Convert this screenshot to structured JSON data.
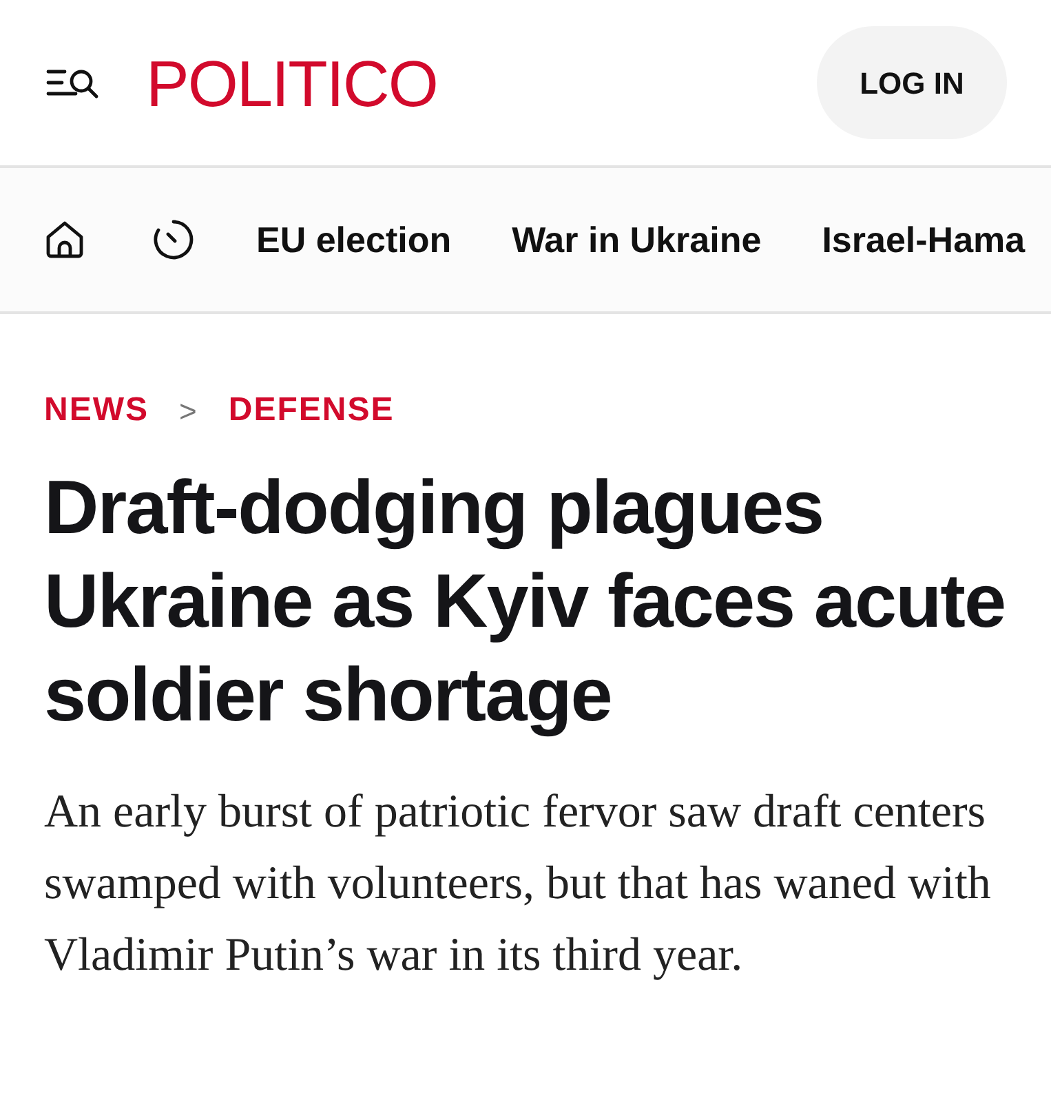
{
  "header": {
    "logo": "POLITICO",
    "login_button": "LOG IN"
  },
  "nav": {
    "items": [
      {
        "label": "EU election"
      },
      {
        "label": "War in Ukraine"
      },
      {
        "label": "Israel-Hama"
      }
    ]
  },
  "breadcrumb": {
    "items": [
      "NEWS",
      "DEFENSE"
    ],
    "separator": ">"
  },
  "article": {
    "headline": "Draft-dodging plagues Ukraine as Kyiv faces acute soldier shortage",
    "deck": "An early burst of patriotic fervor saw draft centers swamped with volunteers, but that has waned with Vladimir Putin’s war in its third year."
  }
}
